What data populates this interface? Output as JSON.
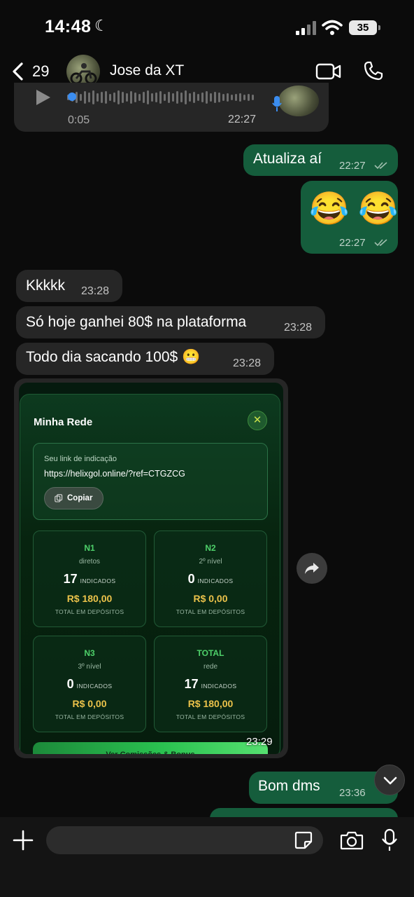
{
  "status_bar": {
    "time": "14:48",
    "moon_icon": "☾",
    "battery": "35"
  },
  "header": {
    "back_count": "29",
    "contact_name": "Jose da XT"
  },
  "messages": {
    "audio": {
      "duration": "0:05",
      "time": "22:27"
    },
    "out1": {
      "text": "Atualiza aí",
      "time": "22:27"
    },
    "out2": {
      "text": "😂 😂",
      "time": "22:27"
    },
    "in1": {
      "text": "Kkkkk",
      "time": "23:28"
    },
    "in2": {
      "text": "Só hoje ganhei 80$ na plataforma",
      "time": "23:28"
    },
    "in3": {
      "text": "Todo dia sacando 100$ 😬",
      "time": "23:28"
    },
    "image": {
      "time": "23:29"
    },
    "out3": {
      "text": "Bom dms",
      "time": "23:36"
    }
  },
  "screenshot": {
    "title": "Minha Rede",
    "close": "✕",
    "ref_label": "Seu link de indicação",
    "ref_link": "https://helixgol.online/?ref=CTGZCG",
    "copy_label": "Copiar",
    "stats": [
      {
        "code": "N1",
        "sub": "diretos",
        "count": "17",
        "count_label": "INDICADOS",
        "amount": "R$ 180,00",
        "foot": "TOTAL EM DEPÓSITOS"
      },
      {
        "code": "N2",
        "sub": "2º nível",
        "count": "0",
        "count_label": "INDICADOS",
        "amount": "R$ 0,00",
        "foot": "TOTAL EM DEPÓSITOS"
      },
      {
        "code": "N3",
        "sub": "3º nível",
        "count": "0",
        "count_label": "INDICADOS",
        "amount": "R$ 0,00",
        "foot": "TOTAL EM DEPÓSITOS"
      },
      {
        "code": "TOTAL",
        "sub": "rede",
        "count": "17",
        "count_label": "INDICADOS",
        "amount": "R$ 180,00",
        "foot": "TOTAL EM DEPÓSITOS"
      }
    ],
    "bottom_button": "Ver Comissões & Bonus"
  },
  "colors": {
    "outgoing_bubble": "#155d3c",
    "incoming_bubble": "#262626",
    "accent_green": "#4ed16a",
    "amount_gold": "#ebc24a"
  },
  "icons": [
    "back-chevron-icon",
    "video-call-icon",
    "phone-icon",
    "play-icon",
    "forward-icon",
    "chevron-down-icon",
    "plus-icon",
    "sticker-icon",
    "camera-icon",
    "microphone-icon",
    "copy-icon",
    "close-icon"
  ]
}
